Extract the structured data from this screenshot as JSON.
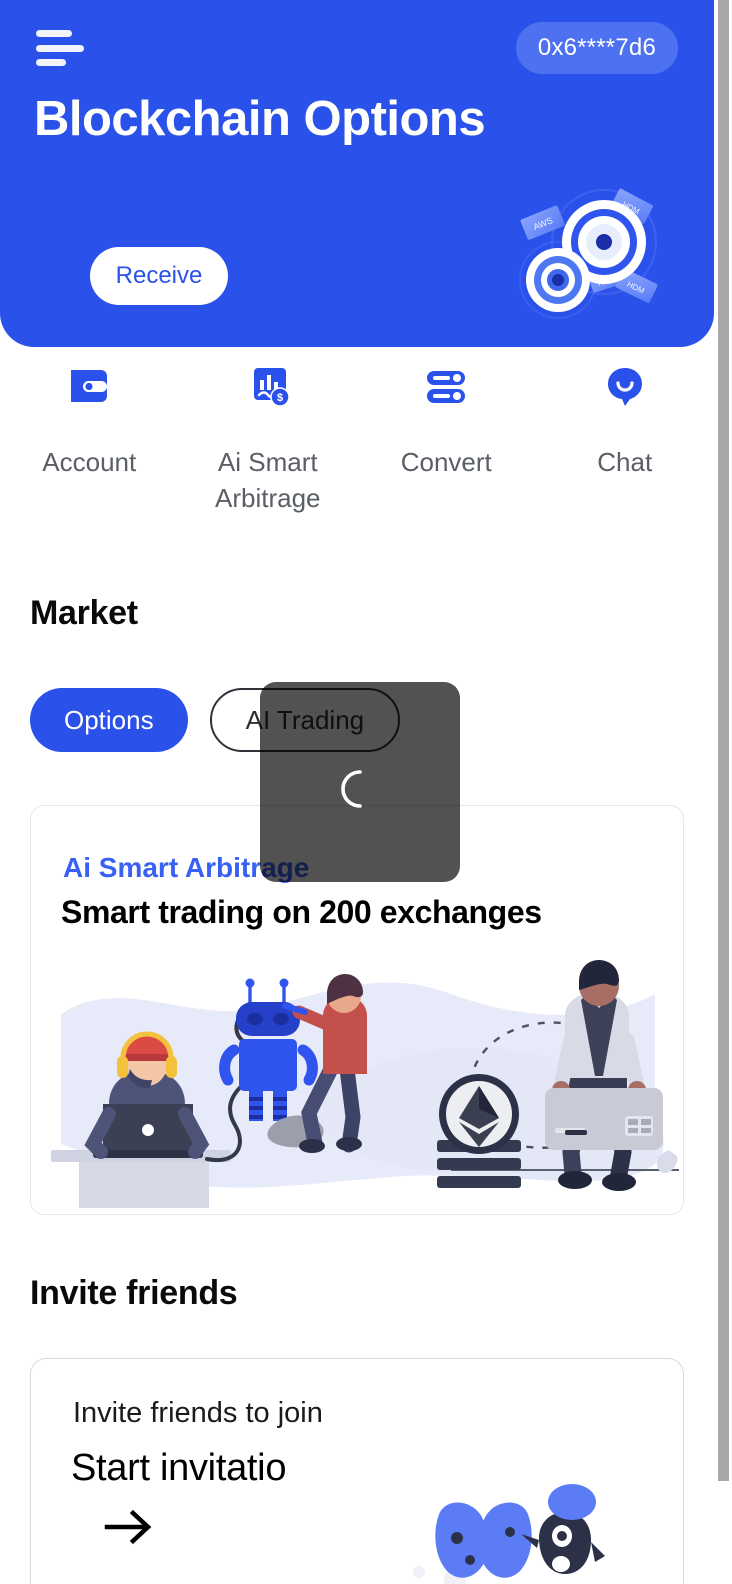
{
  "hero": {
    "menu_icon": "hamburger-menu-icon",
    "wallet_address": "0x6****7d6",
    "title": "Blockchain Options",
    "receive_label": "Receive",
    "art_tags": [
      "AWS",
      "HDM",
      "HDM",
      "HDM"
    ],
    "bg_color": "#2a52ea",
    "badge_color": "#4d71f0"
  },
  "quick_actions": [
    {
      "icon": "wallet-icon",
      "label": "Account"
    },
    {
      "icon": "chart-dollar-icon",
      "label": "Ai Smart Arbitrage"
    },
    {
      "icon": "sliders-icon",
      "label": "Convert"
    },
    {
      "icon": "chat-bubble-icon",
      "label": "Chat"
    }
  ],
  "market": {
    "title": "Market",
    "tabs": [
      {
        "label": "Options",
        "active": true
      },
      {
        "label": "AI Trading",
        "active": false
      }
    ],
    "card": {
      "eyebrow": "Ai Smart Arbitrage",
      "headline": "Smart trading on 200 exchanges",
      "eyebrow_color": "#3860f5"
    }
  },
  "invite": {
    "title": "Invite friends",
    "card": {
      "subtitle": "Invite friends to join",
      "headline": "Start invitatio",
      "arrow_icon": "arrow-right-icon"
    }
  },
  "overlay": {
    "visible": true,
    "spinner_icon": "loading-spinner-icon"
  },
  "scrollbar": {
    "thumb_color": "#a8a8a8"
  }
}
